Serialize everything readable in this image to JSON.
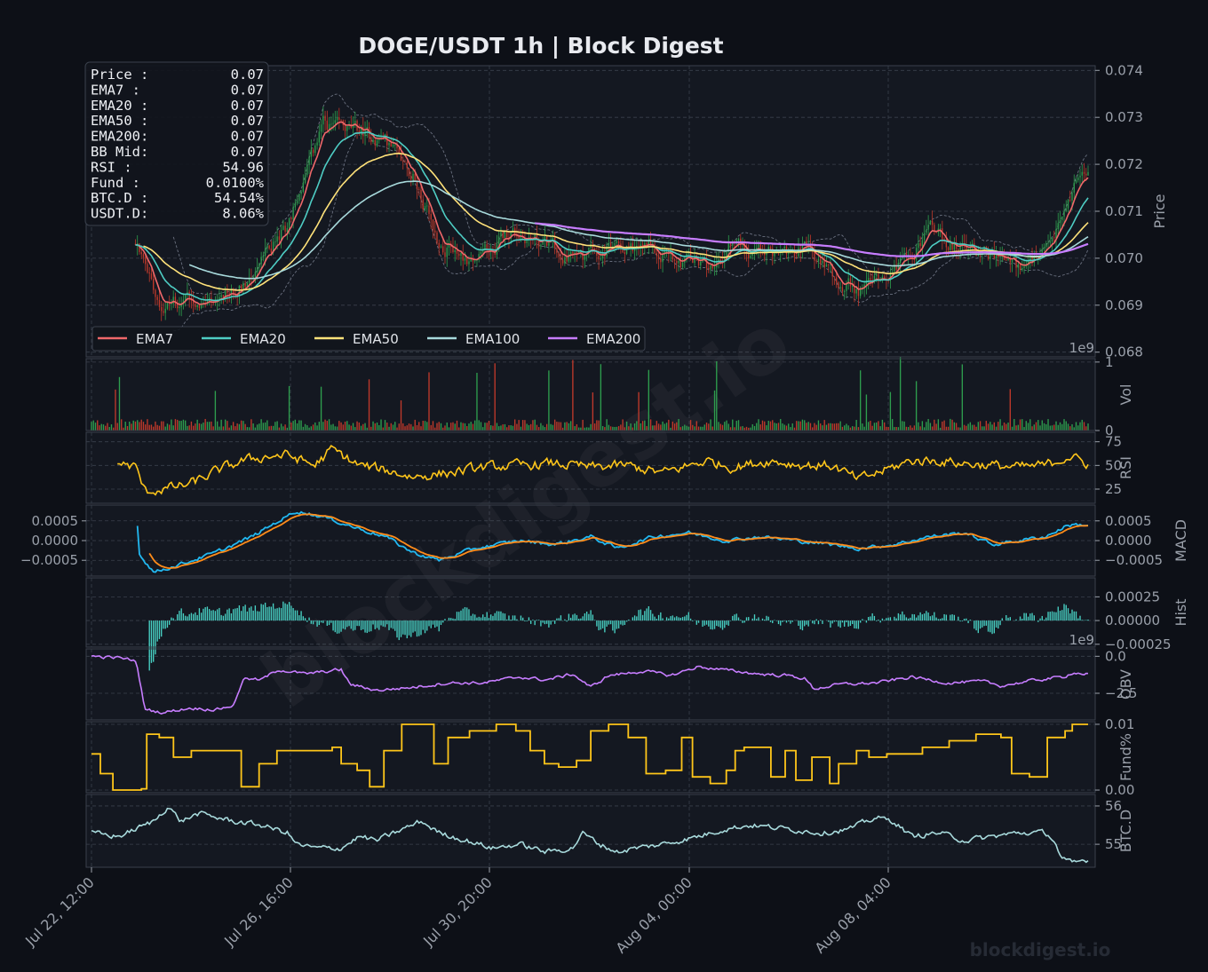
{
  "title": "DOGE/USDT  1h  |  Block Digest",
  "watermark": "blockdigest.io",
  "footer_brand": "blockdigest.io",
  "colors": {
    "background": "#0d1017",
    "panel": "#141821",
    "grid": "#3a404c",
    "ema7": "#f0686a",
    "ema20": "#4ecdc4",
    "ema50": "#ffe27a",
    "ema100": "#a8dadc",
    "ema200": "#c77dff",
    "up": "#2e9e4e",
    "down": "#c0392b",
    "rsi": "#ffc61a",
    "macd": "#22b8f0",
    "signal": "#ff8c1a",
    "hist": "#48d1c4",
    "obv": "#c77dff",
    "fund": "#ffc61a",
    "btcd": "#a8dadc",
    "bb": "#6b7180"
  },
  "info_box": [
    {
      "label": "Price :",
      "value": "0.07"
    },
    {
      "label": "EMA7  :",
      "value": "0.07"
    },
    {
      "label": "EMA20 :",
      "value": "0.07"
    },
    {
      "label": "EMA50 :",
      "value": "0.07"
    },
    {
      "label": "EMA200:",
      "value": "0.07"
    },
    {
      "label": "BB Mid:",
      "value": "0.07"
    },
    {
      "label": "RSI   :",
      "value": "54.96"
    },
    {
      "label": "Fund  :",
      "value": "0.0100%"
    },
    {
      "label": "BTC.D :",
      "value": "54.54%"
    },
    {
      "label": "USDT.D:",
      "value": "8.06%"
    }
  ],
  "legend": [
    "EMA7",
    "EMA20",
    "EMA50",
    "EMA100",
    "EMA200"
  ],
  "x_ticks": [
    "Jul 22, 12:00",
    "Jul 26, 16:00",
    "Jul 30, 20:00",
    "Aug 04, 00:00",
    "Aug 08, 04:00"
  ],
  "panels": {
    "price": {
      "ylabel": "Price",
      "ticks": [
        "0.074",
        "0.073",
        "0.072",
        "0.071",
        "0.070",
        "0.069",
        "0.068"
      ],
      "ylim": [
        0.0679,
        0.0741
      ]
    },
    "vol": {
      "ylabel": "Vol",
      "ticks": [
        "1",
        "0"
      ],
      "offset": "1e9",
      "ylim": [
        0,
        1.05
      ]
    },
    "rsi": {
      "ylabel": "RSI",
      "ticks": [
        "75",
        "50",
        "25"
      ],
      "ylim": [
        10,
        85
      ]
    },
    "macd": {
      "ylabel": "MACD",
      "ticks_left": [
        "0.0005",
        "0.0000",
        "−0.0005"
      ],
      "ticks_right": [
        "0.0005",
        "0.0000",
        "−0.0005"
      ],
      "ylim": [
        -0.0009,
        0.0009
      ]
    },
    "hist": {
      "ylabel": "Hist",
      "ticks": [
        "0.00025",
        "0.00000",
        "−0.00025"
      ],
      "ylim": [
        -0.00028,
        0.00045
      ]
    },
    "obv": {
      "ylabel": "OBV",
      "ticks": [
        "0.0",
        "−2.5"
      ],
      "offset": "1e9",
      "ylim": [
        -4.3,
        0.5
      ]
    },
    "fund": {
      "ylabel": "Fund%",
      "ticks": [
        "0.01",
        "0.00"
      ],
      "ylim": [
        -0.0004,
        0.0104
      ]
    },
    "btcd": {
      "ylabel": "BTC.D",
      "ticks": [
        "56",
        "55"
      ],
      "ylim": [
        54.4,
        56.3
      ]
    }
  },
  "chart_data": {
    "type": "line",
    "title": "DOGE/USDT  1h  |  Block Digest",
    "x_range": [
      "Jul 22, 12:00",
      "Aug 12, 12:00"
    ],
    "n_bars": 500,
    "price_anchors": [
      [
        0,
        null
      ],
      [
        25,
        0.0703
      ],
      [
        40,
        0.069
      ],
      [
        55,
        0.0692
      ],
      [
        70,
        0.0689
      ],
      [
        90,
        0.0697
      ],
      [
        110,
        0.0707
      ],
      [
        130,
        0.0728
      ],
      [
        150,
        0.0727
      ],
      [
        165,
        0.0725
      ],
      [
        180,
        0.0718
      ],
      [
        195,
        0.0703
      ],
      [
        215,
        0.0699
      ],
      [
        235,
        0.0706
      ],
      [
        255,
        0.0703
      ],
      [
        275,
        0.07
      ],
      [
        295,
        0.0703
      ],
      [
        315,
        0.0702
      ],
      [
        330,
        0.07
      ],
      [
        345,
        0.0698
      ],
      [
        360,
        0.0703
      ],
      [
        380,
        0.0701
      ],
      [
        400,
        0.0702
      ],
      [
        415,
        0.0696
      ],
      [
        430,
        0.0693
      ],
      [
        445,
        0.0697
      ],
      [
        460,
        0.07
      ],
      [
        470,
        0.0707
      ],
      [
        480,
        0.0703
      ],
      [
        495,
        0.0702
      ],
      [
        505,
        0.0701
      ],
      [
        520,
        0.0698
      ],
      [
        535,
        0.07
      ],
      [
        548,
        0.0712
      ],
      [
        556,
        0.0721
      ],
      [
        560,
        0.0717
      ]
    ],
    "series": [
      {
        "name": "EMA7",
        "period": 7
      },
      {
        "name": "EMA20",
        "period": 20
      },
      {
        "name": "EMA50",
        "period": 50
      },
      {
        "name": "EMA100",
        "period": 100
      },
      {
        "name": "EMA200",
        "period": 200
      }
    ],
    "rsi_anchors": [
      [
        14,
        53
      ],
      [
        25,
        48
      ],
      [
        30,
        22
      ],
      [
        40,
        25
      ],
      [
        55,
        30
      ],
      [
        70,
        44
      ],
      [
        85,
        55
      ],
      [
        100,
        60
      ],
      [
        110,
        61
      ],
      [
        125,
        50
      ],
      [
        135,
        67
      ],
      [
        150,
        50
      ],
      [
        165,
        45
      ],
      [
        180,
        38
      ],
      [
        200,
        42
      ],
      [
        220,
        48
      ],
      [
        240,
        50
      ],
      [
        260,
        52
      ],
      [
        280,
        48
      ],
      [
        300,
        50
      ],
      [
        320,
        42
      ],
      [
        345,
        55
      ],
      [
        360,
        48
      ],
      [
        380,
        55
      ],
      [
        400,
        50
      ],
      [
        415,
        50
      ],
      [
        430,
        35
      ],
      [
        445,
        45
      ],
      [
        460,
        55
      ],
      [
        475,
        55
      ],
      [
        490,
        52
      ],
      [
        505,
        50
      ],
      [
        520,
        48
      ],
      [
        535,
        50
      ],
      [
        548,
        60
      ],
      [
        558,
        52
      ]
    ],
    "macd_anchors": [
      [
        26,
        -0.0003
      ],
      [
        35,
        -0.0008
      ],
      [
        50,
        -0.0006
      ],
      [
        70,
        -0.0003
      ],
      [
        90,
        0.0001
      ],
      [
        105,
        0.0005
      ],
      [
        115,
        0.00075
      ],
      [
        130,
        0.0006
      ],
      [
        150,
        0.0003
      ],
      [
        165,
        0.0001
      ],
      [
        180,
        -0.0003
      ],
      [
        195,
        -0.0005
      ],
      [
        215,
        -0.0002
      ],
      [
        240,
        0.0
      ],
      [
        260,
        -0.0001
      ],
      [
        280,
        0.0001
      ],
      [
        295,
        -0.0002
      ],
      [
        315,
        0.0001
      ],
      [
        335,
        0.0002
      ],
      [
        355,
        0.0
      ],
      [
        375,
        0.0001
      ],
      [
        395,
        0.0
      ],
      [
        415,
        -0.0001
      ],
      [
        430,
        -0.0002
      ],
      [
        450,
        -0.0001
      ],
      [
        470,
        0.0001
      ],
      [
        490,
        0.0002
      ],
      [
        505,
        -0.0001
      ],
      [
        520,
        0.0
      ],
      [
        535,
        0.0001
      ],
      [
        548,
        0.0004
      ],
      [
        558,
        0.0004
      ]
    ],
    "obv_anchors": [
      [
        0,
        0.0
      ],
      [
        15,
        -0.1
      ],
      [
        25,
        -0.3
      ],
      [
        30,
        -3.6
      ],
      [
        40,
        -3.8
      ],
      [
        55,
        -3.5
      ],
      [
        70,
        -3.6
      ],
      [
        80,
        -3.3
      ],
      [
        85,
        -1.5
      ],
      [
        95,
        -1.6
      ],
      [
        105,
        -0.9
      ],
      [
        120,
        -1.2
      ],
      [
        140,
        -0.9
      ],
      [
        145,
        -1.9
      ],
      [
        160,
        -2.3
      ],
      [
        180,
        -2.1
      ],
      [
        200,
        -1.8
      ],
      [
        220,
        -1.8
      ],
      [
        240,
        -1.4
      ],
      [
        255,
        -1.6
      ],
      [
        270,
        -1.2
      ],
      [
        280,
        -2.1
      ],
      [
        290,
        -1.3
      ],
      [
        310,
        -1.0
      ],
      [
        325,
        -1.3
      ],
      [
        340,
        -0.7
      ],
      [
        360,
        -1.0
      ],
      [
        375,
        -1.2
      ],
      [
        390,
        -1.3
      ],
      [
        400,
        -1.5
      ],
      [
        405,
        -2.2
      ],
      [
        420,
        -1.9
      ],
      [
        440,
        -1.8
      ],
      [
        460,
        -1.4
      ],
      [
        480,
        -1.8
      ],
      [
        500,
        -1.7
      ],
      [
        510,
        -2.0
      ],
      [
        530,
        -1.6
      ],
      [
        545,
        -1.4
      ],
      [
        550,
        -1.1
      ],
      [
        558,
        -1.2
      ]
    ],
    "fund_steps": [
      [
        0,
        0.0055
      ],
      [
        5,
        0.0025
      ],
      [
        12,
        0.0
      ],
      [
        28,
        0.0002
      ],
      [
        31,
        0.0085
      ],
      [
        38,
        0.008
      ],
      [
        46,
        0.005
      ],
      [
        56,
        0.006
      ],
      [
        75,
        0.006
      ],
      [
        84,
        0.0005
      ],
      [
        94,
        0.004
      ],
      [
        104,
        0.006
      ],
      [
        124,
        0.006
      ],
      [
        135,
        0.0065
      ],
      [
        140,
        0.004
      ],
      [
        149,
        0.003
      ],
      [
        156,
        0.0005
      ],
      [
        164,
        0.006
      ],
      [
        174,
        0.01
      ],
      [
        190,
        0.01
      ],
      [
        192,
        0.004
      ],
      [
        200,
        0.008
      ],
      [
        212,
        0.009
      ],
      [
        227,
        0.01
      ],
      [
        238,
        0.009
      ],
      [
        246,
        0.006
      ],
      [
        254,
        0.004
      ],
      [
        262,
        0.0035
      ],
      [
        272,
        0.0045
      ],
      [
        280,
        0.009
      ],
      [
        290,
        0.01
      ],
      [
        301,
        0.008
      ],
      [
        311,
        0.0025
      ],
      [
        322,
        0.003
      ],
      [
        331,
        0.008
      ],
      [
        337,
        0.002
      ],
      [
        347,
        0.001
      ],
      [
        356,
        0.003
      ],
      [
        361,
        0.006
      ],
      [
        366,
        0.0065
      ],
      [
        381,
        0.002
      ],
      [
        389,
        0.006
      ],
      [
        395,
        0.0015
      ],
      [
        404,
        0.005
      ],
      [
        414,
        0.001
      ],
      [
        419,
        0.004
      ],
      [
        429,
        0.006
      ],
      [
        436,
        0.005
      ],
      [
        446,
        0.0055
      ],
      [
        456,
        0.0055
      ],
      [
        466,
        0.0065
      ],
      [
        481,
        0.0075
      ],
      [
        496,
        0.0085
      ],
      [
        510,
        0.008
      ],
      [
        516,
        0.0025
      ],
      [
        526,
        0.002
      ],
      [
        536,
        0.008
      ],
      [
        546,
        0.009
      ],
      [
        550,
        0.01
      ]
    ],
    "btcd_anchors": [
      [
        0,
        55.3
      ],
      [
        15,
        55.2
      ],
      [
        25,
        55.4
      ],
      [
        35,
        55.6
      ],
      [
        43,
        56.0
      ],
      [
        50,
        55.6
      ],
      [
        60,
        55.8
      ],
      [
        80,
        55.6
      ],
      [
        95,
        55.5
      ],
      [
        110,
        55.3
      ],
      [
        115,
        55.0
      ],
      [
        125,
        54.9
      ],
      [
        140,
        54.9
      ],
      [
        150,
        55.2
      ],
      [
        160,
        55.1
      ],
      [
        175,
        55.4
      ],
      [
        185,
        55.6
      ],
      [
        195,
        55.3
      ],
      [
        210,
        55.1
      ],
      [
        225,
        54.9
      ],
      [
        240,
        55.0
      ],
      [
        255,
        54.8
      ],
      [
        270,
        54.9
      ],
      [
        275,
        55.3
      ],
      [
        285,
        55.0
      ],
      [
        295,
        54.8
      ],
      [
        305,
        54.9
      ],
      [
        320,
        55.0
      ],
      [
        340,
        55.2
      ],
      [
        355,
        55.4
      ],
      [
        370,
        55.5
      ],
      [
        390,
        55.4
      ],
      [
        410,
        55.3
      ],
      [
        425,
        55.4
      ],
      [
        440,
        55.7
      ],
      [
        450,
        55.6
      ],
      [
        460,
        55.2
      ],
      [
        475,
        55.3
      ],
      [
        490,
        55.1
      ],
      [
        505,
        55.2
      ],
      [
        520,
        55.3
      ],
      [
        535,
        55.3
      ],
      [
        540,
        55.1
      ],
      [
        544,
        54.6
      ],
      [
        550,
        54.5
      ],
      [
        558,
        54.6
      ]
    ]
  }
}
